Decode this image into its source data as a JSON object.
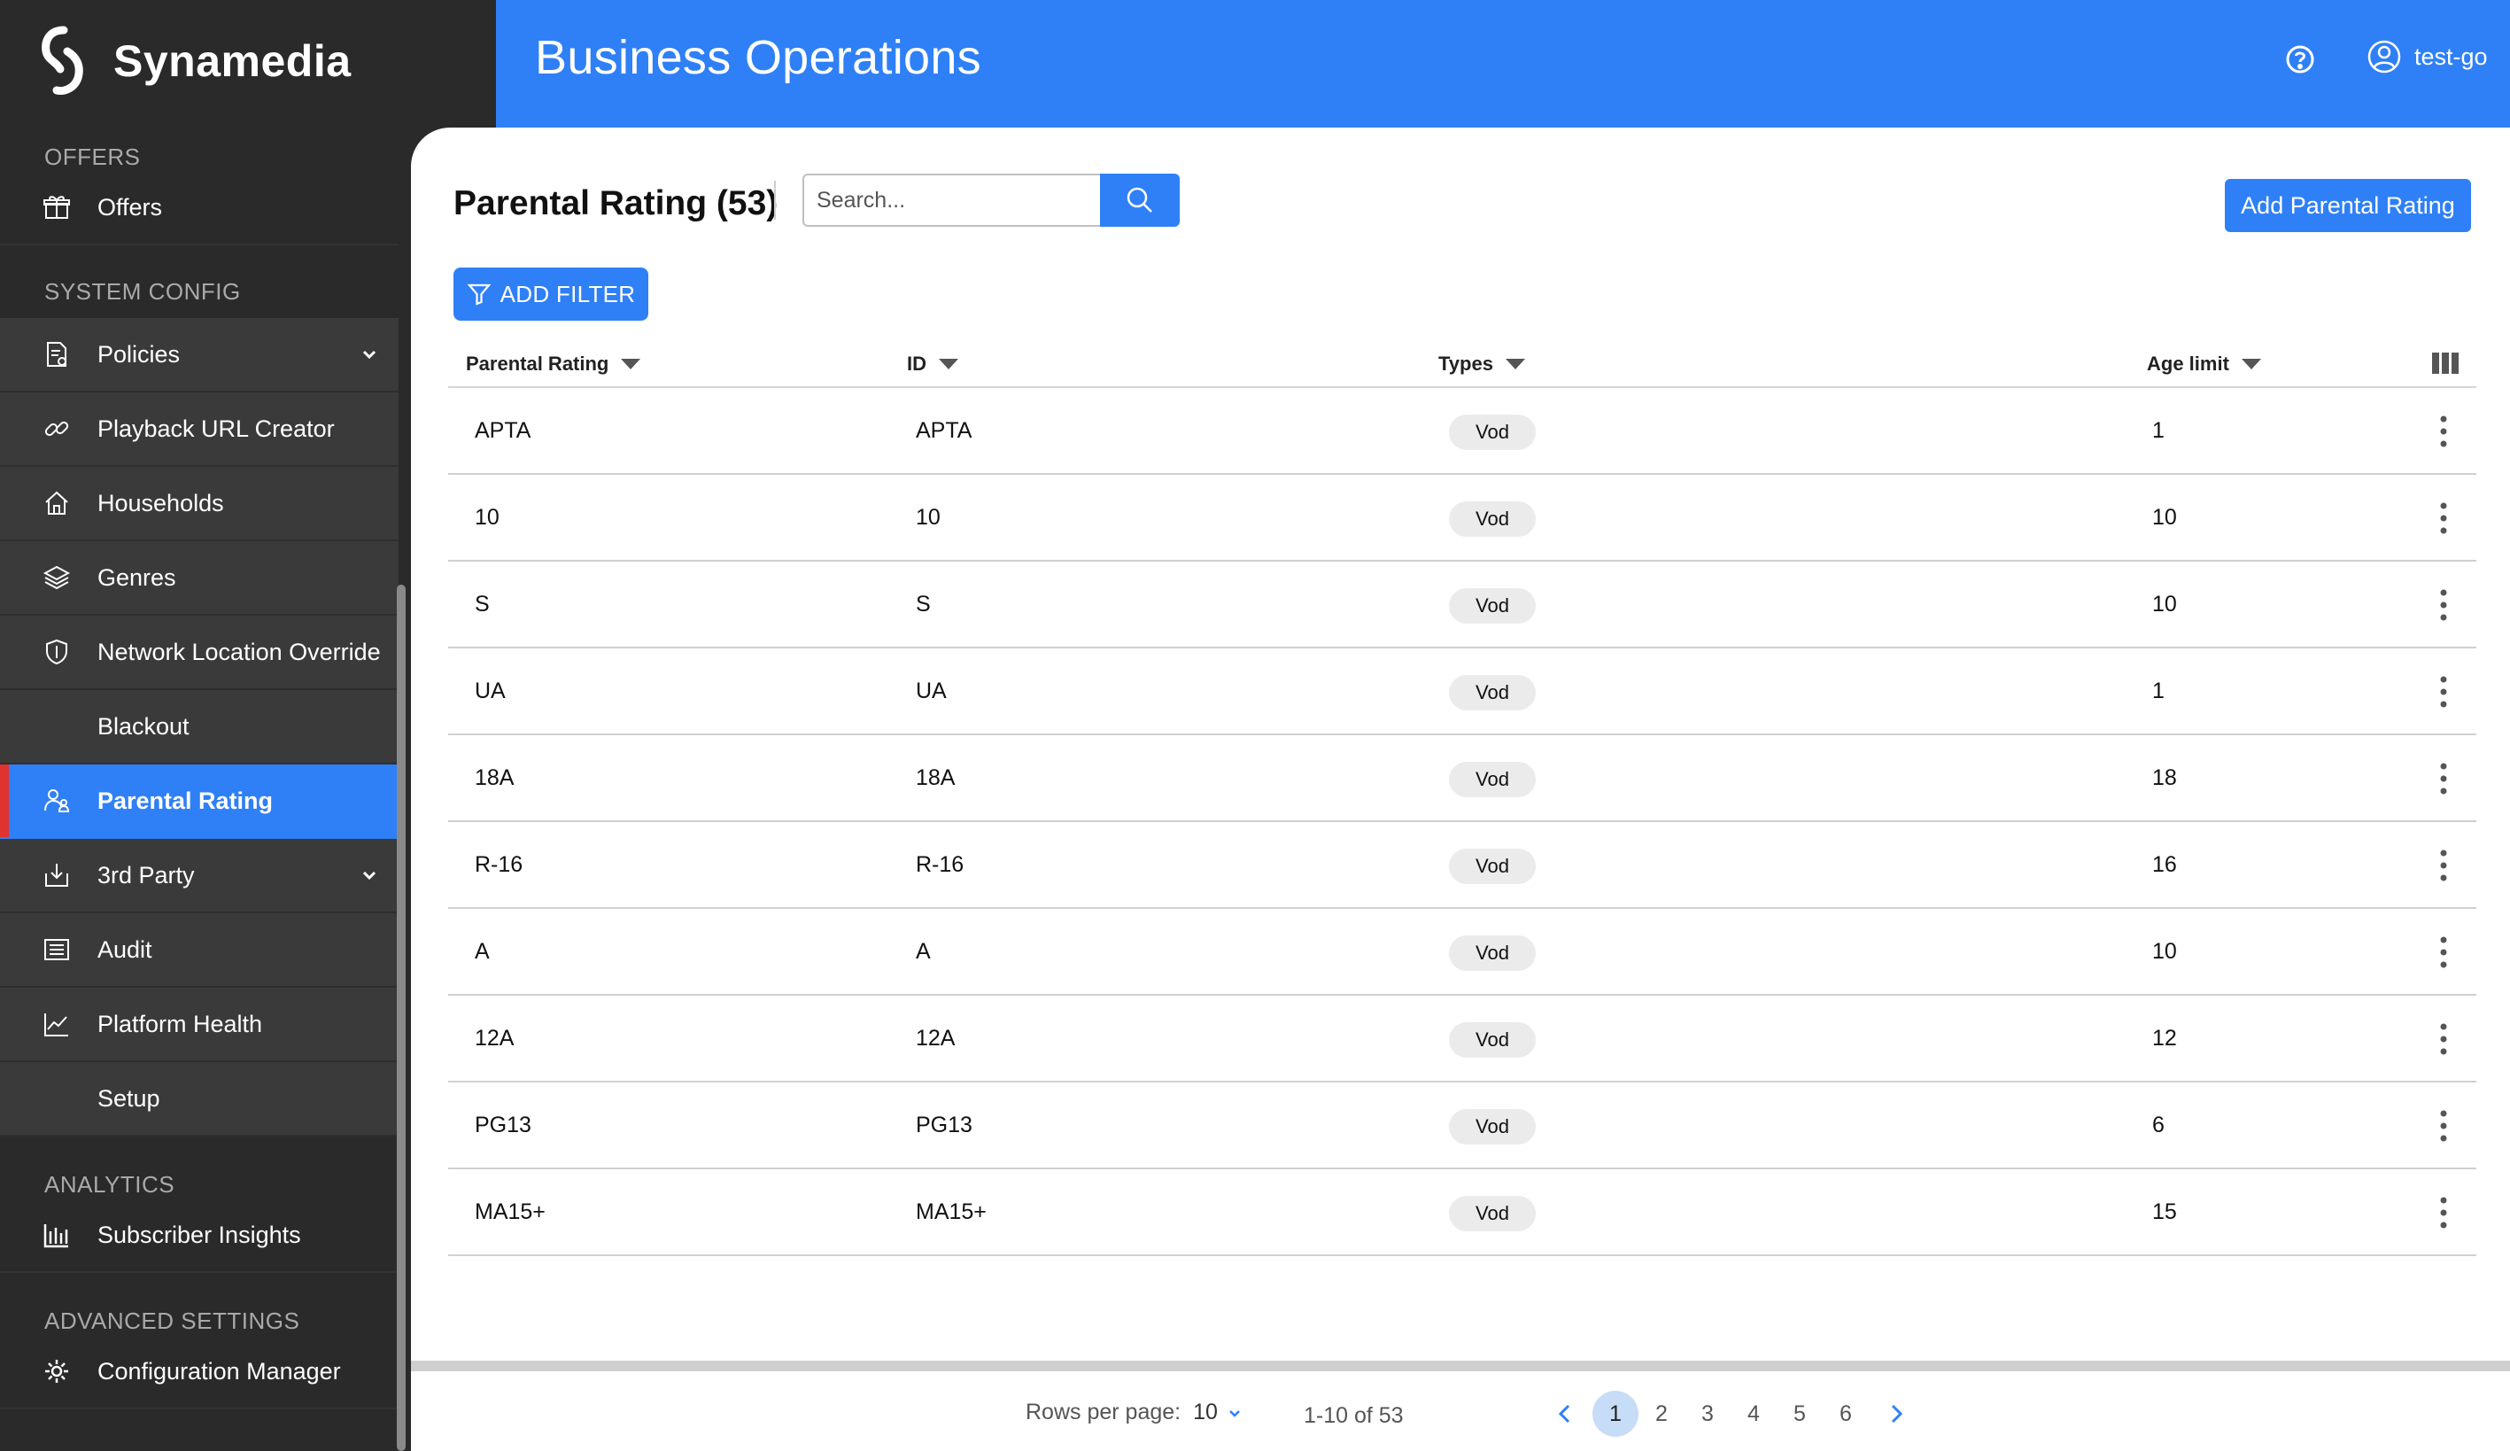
{
  "brand": {
    "name": "Synamedia"
  },
  "header": {
    "title": "Business Operations",
    "help_icon": "help-circle-icon",
    "user": "test-go"
  },
  "sidebar": {
    "sections": [
      {
        "label": "OFFERS",
        "items": [
          {
            "label": "Offers",
            "icon": "gift-icon"
          }
        ]
      },
      {
        "label": "SYSTEM CONFIG",
        "items": [
          {
            "label": "Policies",
            "icon": "policy-doc-icon",
            "expandable": true
          },
          {
            "label": "Playback URL Creator",
            "icon": "link-icon"
          },
          {
            "label": "Households",
            "icon": "home-icon"
          },
          {
            "label": "Genres",
            "icon": "layers-icon"
          },
          {
            "label": "Network Location Override",
            "icon": "shield-icon"
          },
          {
            "label": "Blackout",
            "icon": ""
          },
          {
            "label": "Parental Rating",
            "icon": "parent-child-icon",
            "active": true
          },
          {
            "label": "3rd Party",
            "icon": "download-box-icon",
            "expandable": true
          },
          {
            "label": "Audit",
            "icon": "list-icon"
          },
          {
            "label": "Platform Health",
            "icon": "chart-line-icon"
          },
          {
            "label": "Setup",
            "icon": ""
          }
        ]
      },
      {
        "label": "ANALYTICS",
        "items": [
          {
            "label": "Subscriber Insights",
            "icon": "bar-chart-icon"
          }
        ]
      },
      {
        "label": "ADVANCED SETTINGS",
        "items": [
          {
            "label": "Configuration Manager",
            "icon": "gear-icon"
          }
        ]
      }
    ]
  },
  "page": {
    "title": "Parental Rating (53)",
    "search_placeholder": "Search...",
    "add_button": "Add Parental Rating",
    "filter_button": "ADD FILTER"
  },
  "table": {
    "columns": [
      "Parental Rating",
      "ID",
      "Types",
      "Age limit"
    ],
    "rows": [
      {
        "rating": "APTA",
        "id": "APTA",
        "type": "Vod",
        "age": "1"
      },
      {
        "rating": "10",
        "id": "10",
        "type": "Vod",
        "age": "10"
      },
      {
        "rating": "S",
        "id": "S",
        "type": "Vod",
        "age": "10"
      },
      {
        "rating": "UA",
        "id": "UA",
        "type": "Vod",
        "age": "1"
      },
      {
        "rating": "18A",
        "id": "18A",
        "type": "Vod",
        "age": "18"
      },
      {
        "rating": "R-16",
        "id": "R-16",
        "type": "Vod",
        "age": "16"
      },
      {
        "rating": "A",
        "id": "A",
        "type": "Vod",
        "age": "10"
      },
      {
        "rating": "12A",
        "id": "12A",
        "type": "Vod",
        "age": "12"
      },
      {
        "rating": "PG13",
        "id": "PG13",
        "type": "Vod",
        "age": "6"
      },
      {
        "rating": "MA15+",
        "id": "MA15+",
        "type": "Vod",
        "age": "15"
      }
    ]
  },
  "pagination": {
    "rows_per_page_label": "Rows per page:",
    "rows_per_page": "10",
    "range": "1-10 of 53",
    "pages": [
      "1",
      "2",
      "3",
      "4",
      "5",
      "6"
    ],
    "current_page": "1"
  },
  "colors": {
    "primary": "#2f80f6",
    "sidebar_bg": "#2a2a2a",
    "active_marker": "#e0332f"
  }
}
